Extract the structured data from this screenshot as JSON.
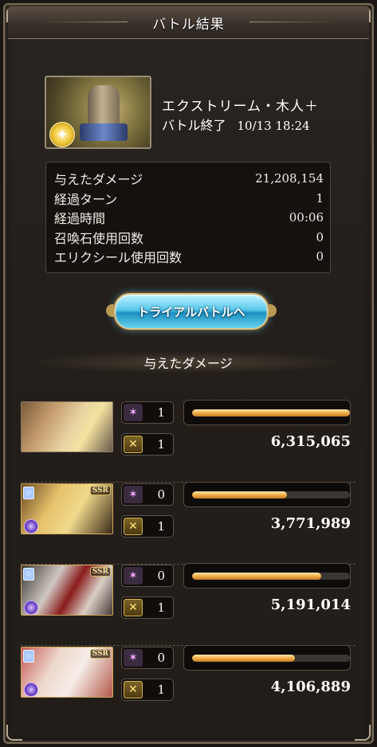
{
  "window": {
    "title": "バトル結果"
  },
  "quest": {
    "name": "エクストリーム・木人＋",
    "status": "バトル終了",
    "datetime": "10/13 18:24",
    "thumbnail_icon": "training-dummy-icon",
    "element_badge_icon": "light-element-icon"
  },
  "stats": [
    {
      "label": "与えたダメージ",
      "value": "21,208,154"
    },
    {
      "label": "経過ターン",
      "value": "1"
    },
    {
      "label": "経過時間",
      "value": "00:06"
    },
    {
      "label": "召喚石使用回数",
      "value": "0"
    },
    {
      "label": "エリクシール使用回数",
      "value": "0"
    }
  ],
  "trial_button": {
    "label": "トライアルバトルへ"
  },
  "damage_section": {
    "title": "与えたダメージ"
  },
  "members": [
    {
      "portrait": "main-character-pair",
      "ca_count": "1",
      "skill_count": "1",
      "damage": "6,315,065",
      "share": 1.0,
      "rarity": ""
    },
    {
      "portrait": "ssr-character",
      "ca_count": "0",
      "skill_count": "1",
      "damage": "3,771,989",
      "share": 0.6,
      "rarity": "SSR"
    },
    {
      "portrait": "ssr-character",
      "ca_count": "0",
      "skill_count": "1",
      "damage": "5,191,014",
      "share": 0.82,
      "rarity": "SSR"
    },
    {
      "portrait": "ssr-character",
      "ca_count": "0",
      "skill_count": "1",
      "damage": "4,106,889",
      "share": 0.65,
      "rarity": "SSR"
    }
  ],
  "colors": {
    "bar_fill": "#f0b04a",
    "button": "#59c9ec",
    "frame": "#7a6c5a"
  }
}
